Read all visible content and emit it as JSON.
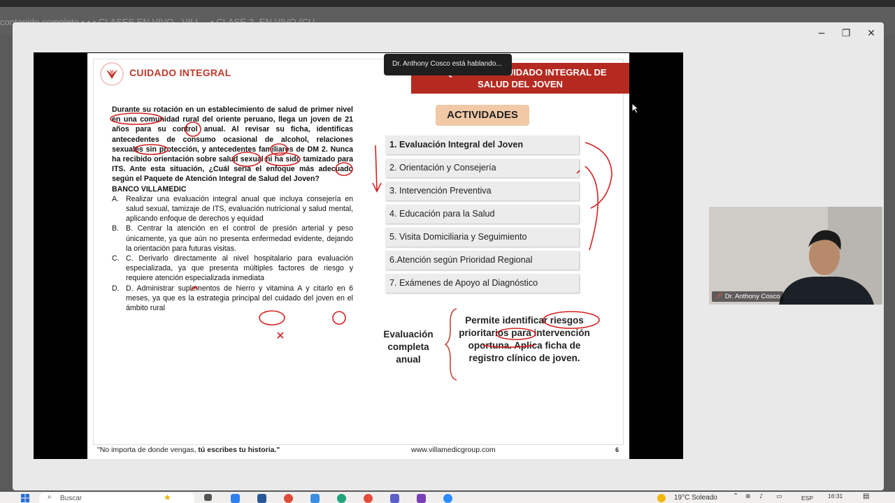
{
  "background_strip": {
    "text": "contenido completo    •    •    •    CLASES EN VIVO - VILL...    •    CLASE 2- EN VIVO (CU..."
  },
  "window_controls": {
    "minimize": "−",
    "restore": "❐",
    "close": "✕"
  },
  "speaking_indicator": "Dr. Anthony Cosco está hablando...",
  "slide": {
    "logo_text": "CUIDADO INTEGRAL",
    "banner_line1": "PAQUETE DEL CUIDADO INTEGRAL DE",
    "banner_line2": "SALUD DEL JOVEN",
    "question_stem": "Durante su rotación en un establecimiento de salud de primer nivel en una comunidad rural del oriente peruano, llega un joven de 21 años para su control anual. Al revisar su ficha, identificas antecedentes de consumo ocasional de alcohol, relaciones sexuales sin protección, y antecedentes familiares de DM 2. Nunca ha recibido orientación sobre salud sexual ni ha sido tamizado para ITS. Ante esta situación, ¿Cuál sería el enfoque más adecuado según el Paquete de Atención Integral de Salud del Joven?",
    "bank": "BANCO VILLAMEDIC",
    "options": [
      {
        "letter": "A.",
        "text": "Realizar una evaluación integral anual que incluya consejería en salud sexual, tamizaje de ITS, evaluación nutricional y salud mental, aplicando enfoque de derechos y equidad"
      },
      {
        "letter": "B.",
        "text": "B. Centrar la atención en el control de presión arterial y peso únicamente, ya que aún no presenta enfermedad evidente, dejando la orientación para futuras visitas."
      },
      {
        "letter": "C.",
        "text": "C. Derivarlo directamente al nivel hospitalario para evaluación especializada, ya que presenta múltiples factores de riesgo y requiere atención especializada inmediata"
      },
      {
        "letter": "D.",
        "text": "D. Administrar suplementos de hierro y vitamina A y citarlo en 6 meses, ya que es la estrategia principal del cuidado del joven en el ámbito rural"
      }
    ],
    "activities_title": "ACTIVIDADES",
    "activities": [
      "1. Evaluación Integral del Joven",
      "2. Orientación y Consejería",
      "3. Intervención Preventiva",
      "4. Educación para la Salud",
      "5. Visita Domiciliaria y Seguimiento",
      "6.Atención según Prioridad Regional",
      "7. Exámenes de Apoyo al Diagnóstico"
    ],
    "eval_label": "Evaluación completa anual",
    "eval_text": "Permite identificar riesgos prioritarios para intervención oportuna. Aplica ficha de registro clínico de joven.",
    "footer_quote_plain": "\"No importa de donde vengas, ",
    "footer_quote_bold": "tú escribes tu historia.\"",
    "footer_url": "www.villamedicgroup.com",
    "page_number": "6"
  },
  "webcam": {
    "name": "Dr. Anthony Cosco"
  },
  "taskbar": {
    "search_placeholder": "Buscar",
    "weather": "19°C  Soleado",
    "language": "ESP",
    "time": "16:31"
  },
  "colors": {
    "brand_red": "#b52a20",
    "activities_title_bg": "#f2c9a6",
    "annotation_red": "#d42020"
  }
}
